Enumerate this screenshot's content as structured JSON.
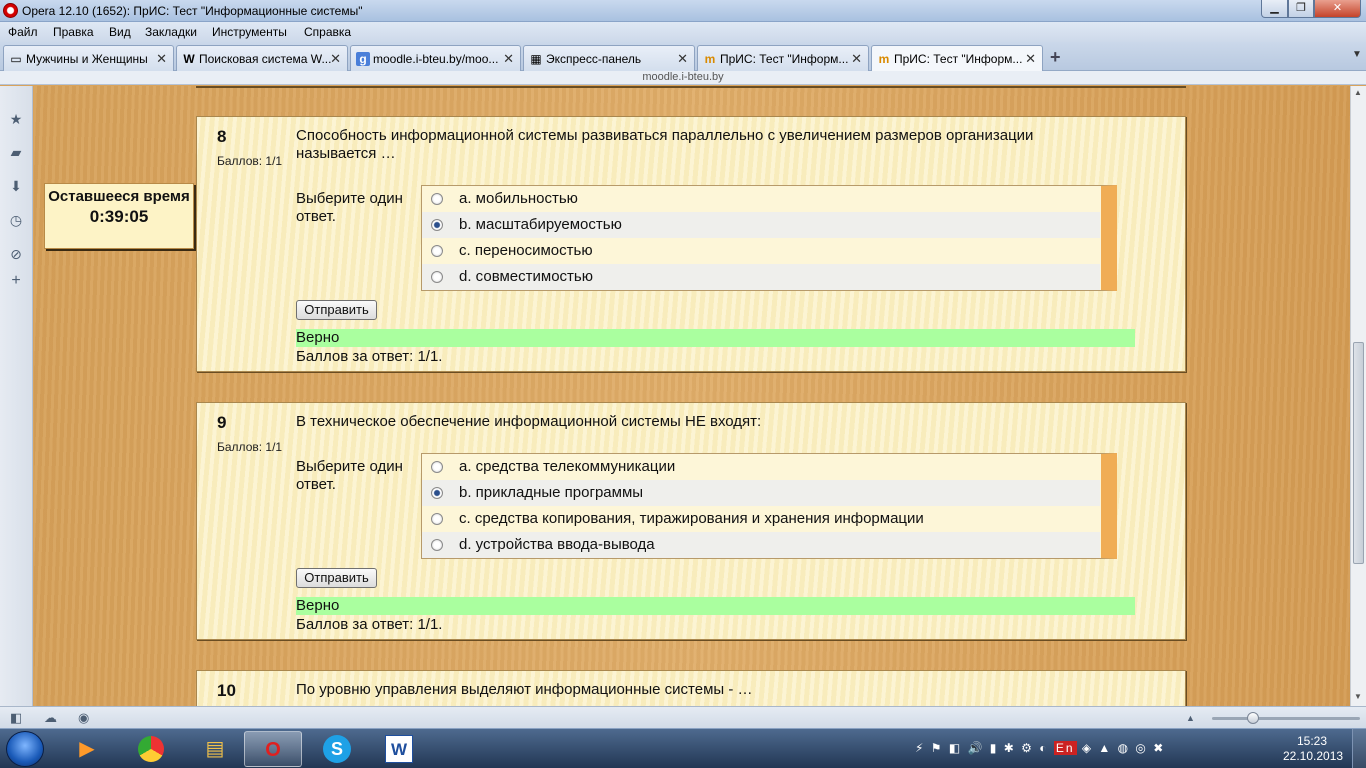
{
  "window": {
    "title": "Opera 12.10 (1652): ПрИС: Тест \"Информационные системы\""
  },
  "menu": [
    "Файл",
    "Правка",
    "Вид",
    "Закладки",
    "Инструменты",
    "Справка"
  ],
  "tabs": [
    {
      "label": "Мужчины и Женщины",
      "favicon": "page-icon"
    },
    {
      "label": "Поисковая система W...",
      "favicon": "W"
    },
    {
      "label": "moodle.i-bteu.by/moo...",
      "favicon": "g"
    },
    {
      "label": "Экспресс-панель",
      "favicon": "grid-icon"
    },
    {
      "label": "ПрИС: Тест \"Информ...",
      "favicon": "moodle-icon"
    },
    {
      "label": "ПрИС: Тест \"Информ...",
      "favicon": "moodle-icon"
    }
  ],
  "address": {
    "host": "moodle.i-bteu.by"
  },
  "timer": {
    "label": "Оставшееся время",
    "value": "0:39:05"
  },
  "questions": [
    {
      "number": "8",
      "grade": "Баллов: 1/1",
      "text": "Способность информационной системы развиваться параллельно с увеличением размеров организации называется …",
      "prompt": "Выберите один ответ.",
      "answers": [
        {
          "label": "a. мобильностью",
          "checked": false
        },
        {
          "label": "b. масштабируемостью",
          "checked": true
        },
        {
          "label": "c. переносимостью",
          "checked": false
        },
        {
          "label": "d. совместимостью",
          "checked": false
        }
      ],
      "submit_label": "Отправить",
      "verdict": "Верно",
      "score": "Баллов за ответ: 1/1."
    },
    {
      "number": "9",
      "grade": "Баллов: 1/1",
      "text": "В техническое обеспечение информационной системы НЕ входят:",
      "prompt": "Выберите один ответ.",
      "answers": [
        {
          "label": "a. средства телекоммуникации",
          "checked": false
        },
        {
          "label": "b. прикладные программы",
          "checked": true
        },
        {
          "label": "c. средства копирования, тиражирования и хранения информации",
          "checked": false
        },
        {
          "label": "d. устройства ввода-вывода",
          "checked": false
        }
      ],
      "submit_label": "Отправить",
      "verdict": "Верно",
      "score": "Баллов за ответ: 1/1."
    },
    {
      "number": "10",
      "text": "По уровню управления выделяют информационные системы - …"
    }
  ],
  "taskbar": {
    "apps": [
      "media-player-icon",
      "chrome-icon",
      "explorer-icon",
      "opera-icon",
      "skype-icon",
      "word-icon"
    ],
    "language": "En",
    "time": "15:23",
    "date": "22.10.2013"
  },
  "colors": {
    "verdict_bg": "#aaff9f",
    "page_bg": "#d9a35b",
    "question_bg": "#fbf1c4"
  }
}
